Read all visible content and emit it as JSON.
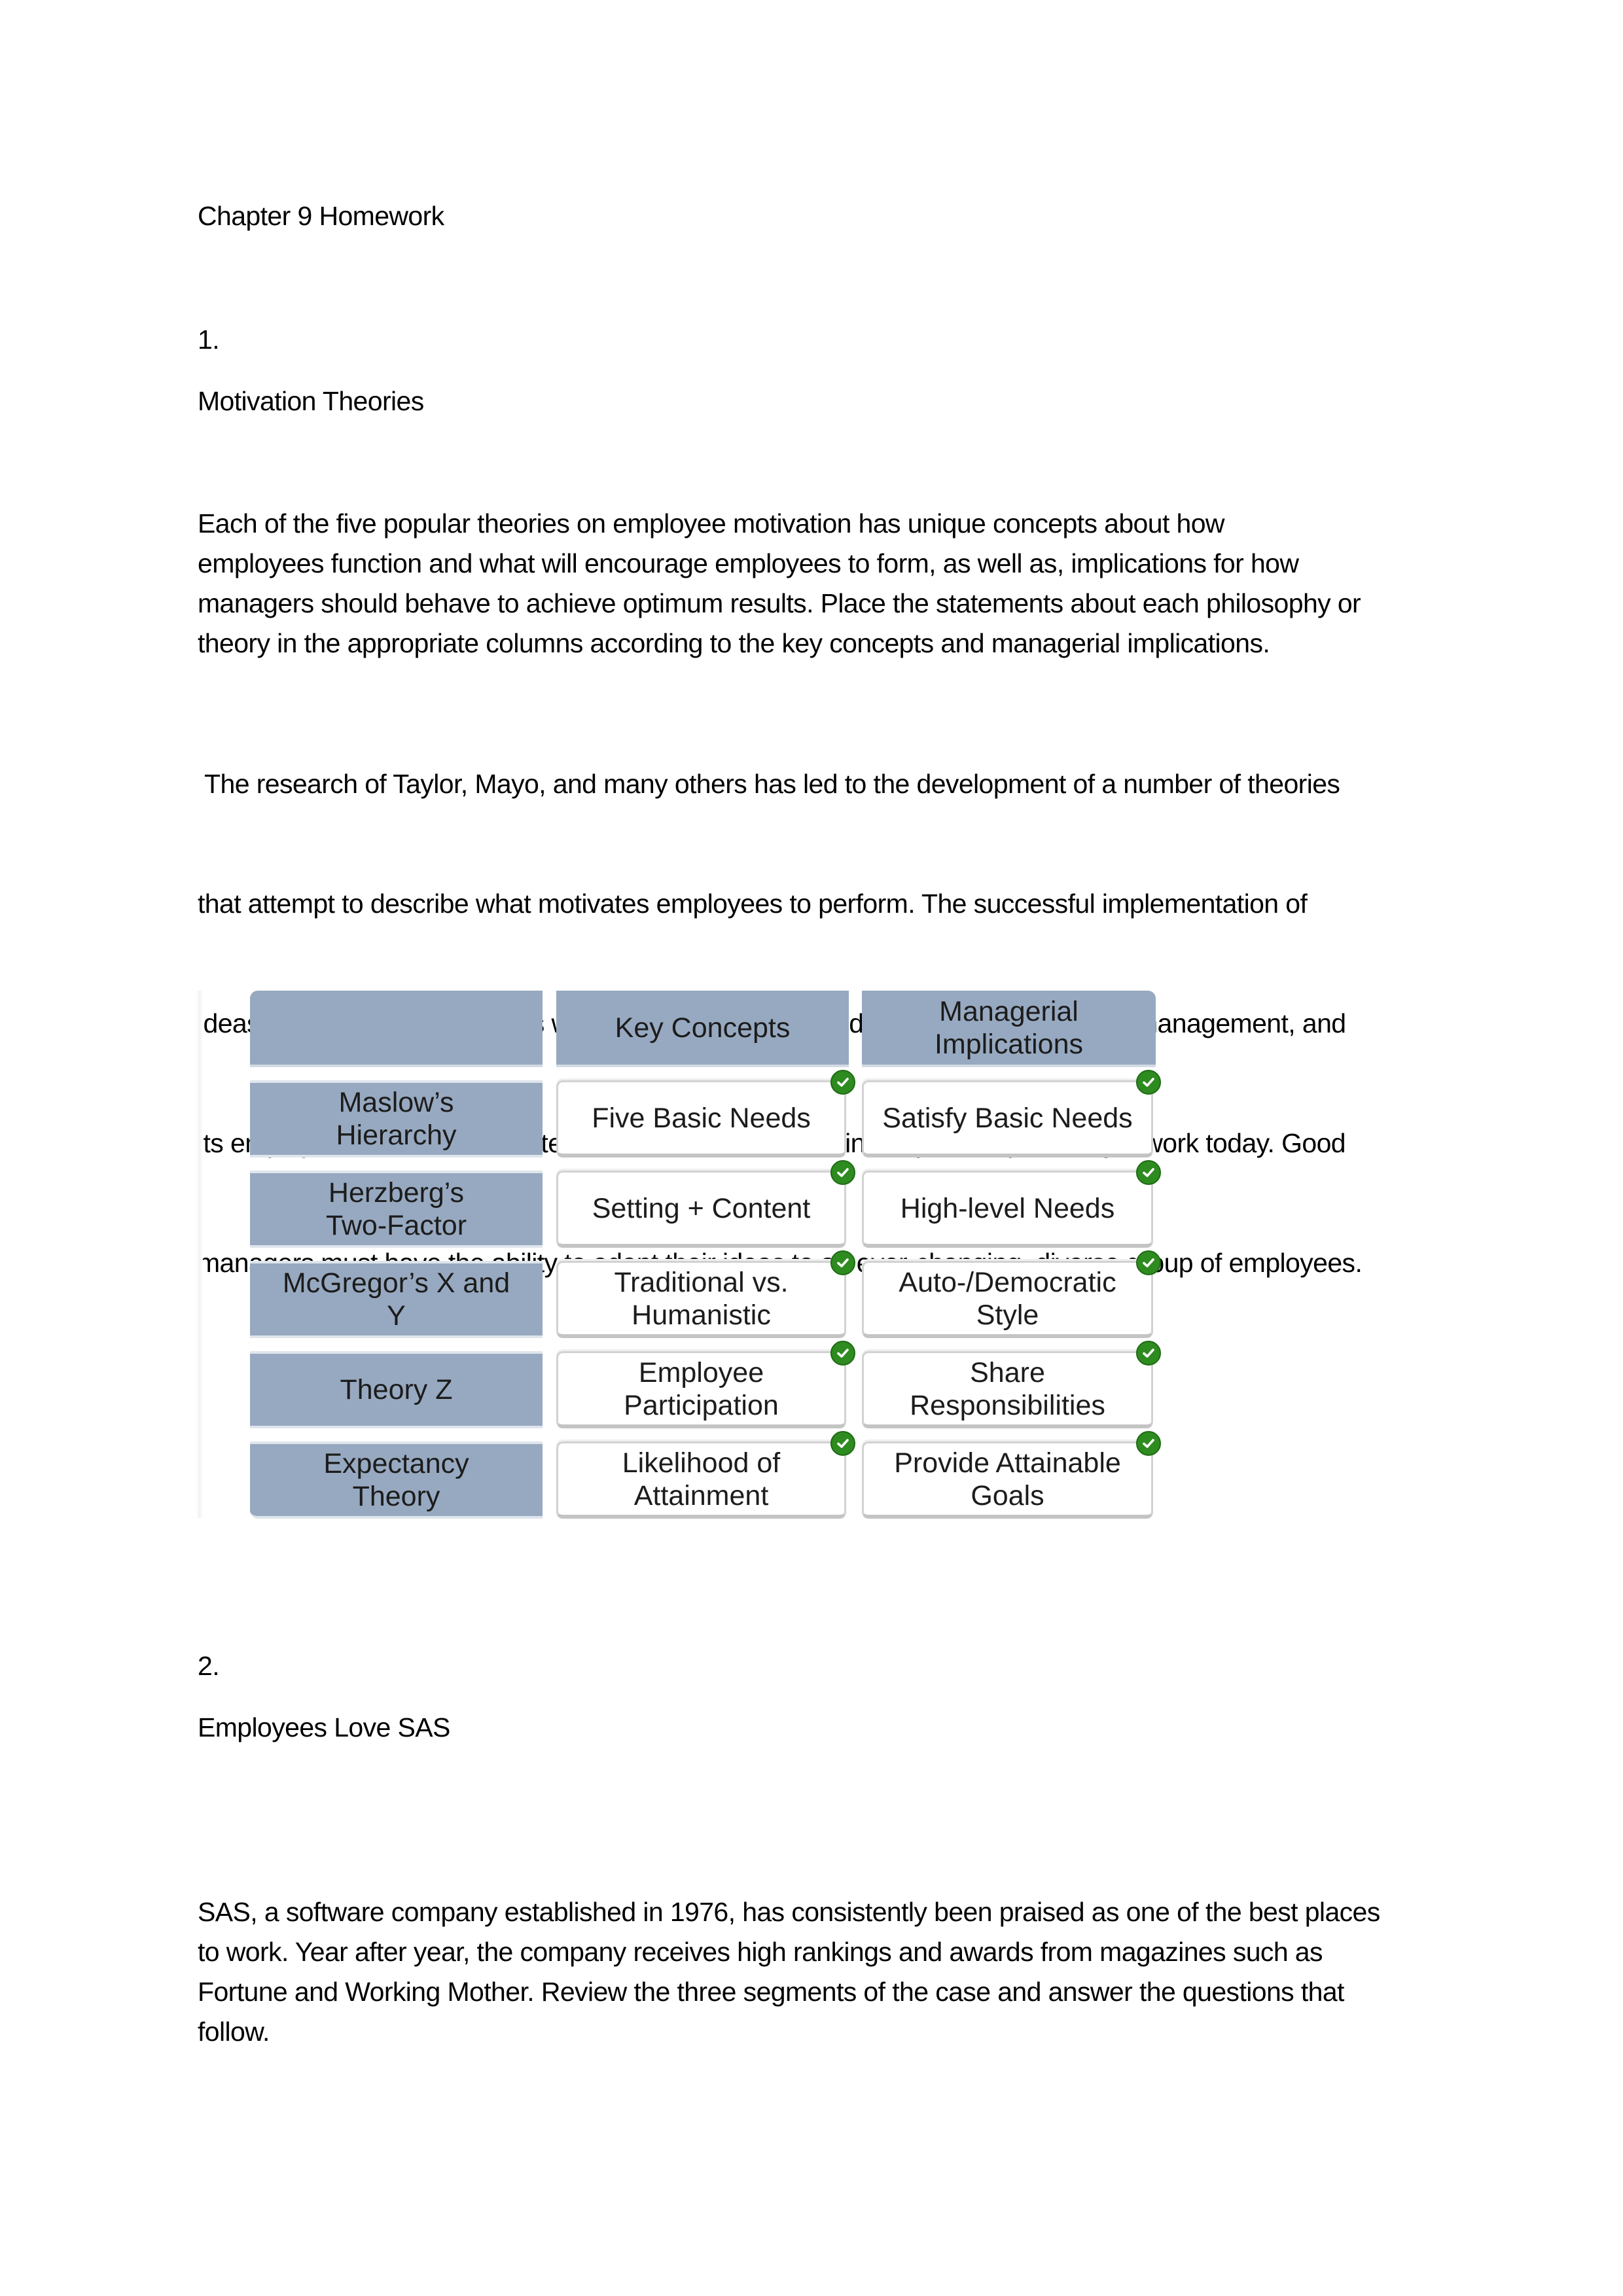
{
  "document": {
    "title": "Chapter 9 Homework",
    "sections": [
      {
        "number": "1.",
        "heading": "Motivation Theories",
        "paragraphs": [
          {
            "lines": [
              "Each of the five popular theories on employee motivation has unique concepts about how",
              "employees function and what will encourage employees to form, as well as, implications for how",
              "managers should behave to achieve optimum results. Place the statements about each philosophy or",
              "theory in the appropriate columns according to the key concepts and managerial implications."
            ]
          },
          {
            "lines": [
              " The research of Taylor, Mayo, and many others has led to the development of a number of theories",
              "that attempt to describe what motivates employees to perform. The successful implementation of",
              "ideas based on these theories will vary, of course, depending on the company, its management, and",
              "its employees. It should be noted, too, that what worked in the past may no longer work today. Good",
              "managers must have the ability to adapt their ideas to an ever-changing, diverse group of employees."
            ]
          }
        ],
        "table": {
          "headers": [
            "",
            "Key Concepts",
            "Managerial Implications"
          ],
          "header_lines": [
            [
              ""
            ],
            [
              "Key Concepts"
            ],
            [
              "Managerial",
              "Implications"
            ]
          ],
          "rows": [
            {
              "theory": [
                "Maslow’s",
                "Hierarchy"
              ],
              "key_concept": [
                "Five Basic Needs"
              ],
              "implication": [
                "Satisfy Basic Needs"
              ],
              "key_correct": true,
              "impl_correct": true
            },
            {
              "theory": [
                "Herzberg’s",
                "Two-Factor"
              ],
              "key_concept": [
                "Setting + Content"
              ],
              "implication": [
                "High-level Needs"
              ],
              "key_correct": true,
              "impl_correct": true
            },
            {
              "theory": [
                "McGregor’s X and",
                "Y"
              ],
              "key_concept": [
                "Traditional vs.",
                "Humanistic"
              ],
              "implication": [
                "Auto-/Democratic",
                "Style"
              ],
              "key_correct": true,
              "impl_correct": true
            },
            {
              "theory": [
                "Theory Z"
              ],
              "key_concept": [
                "Employee",
                "Participation"
              ],
              "implication": [
                "Share",
                "Responsibilities"
              ],
              "key_correct": true,
              "impl_correct": true
            },
            {
              "theory": [
                "Expectancy",
                "Theory"
              ],
              "key_concept": [
                "Likelihood of",
                "Attainment"
              ],
              "implication": [
                "Provide Attainable",
                "Goals"
              ],
              "key_correct": true,
              "impl_correct": true
            }
          ],
          "icons": {
            "correct": "check-circle-icon"
          },
          "colors": {
            "header_bg": "#97a9c0",
            "check_green": "#2e8b1f"
          }
        }
      },
      {
        "number": "2.",
        "heading": "Employees Love SAS",
        "paragraphs": [
          {
            "lines": [
              "SAS, a software company established in 1976, has consistently been praised as one of the best places",
              "to work. Year after year, the company receives high rankings and awards from magazines such as",
              "Fortune and Working Mother. Review the three segments of the case and answer the questions that",
              "follow."
            ]
          }
        ]
      }
    ]
  }
}
